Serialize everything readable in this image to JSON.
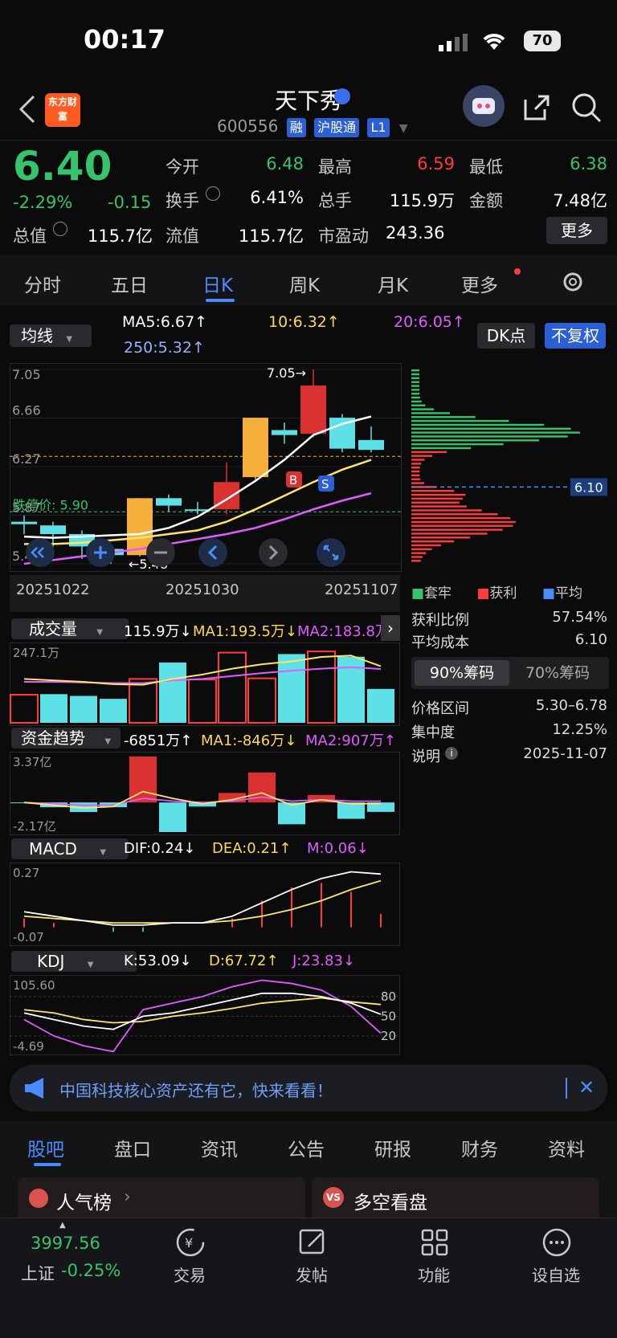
{
  "status": {
    "time": "00:17",
    "battery": "70"
  },
  "header": {
    "logo_text": "东方财富",
    "stock_name": "天下秀",
    "stock_code": "600556",
    "tags": [
      "融",
      "沪股通",
      "L1"
    ]
  },
  "quote": {
    "price": "6.40",
    "change_pct": "-2.29%",
    "change": "-0.15",
    "market_cap_label": "总值",
    "market_cap": "115.7亿",
    "float_cap_label": "流值",
    "float_cap": "115.7亿",
    "open_label": "今开",
    "open": "6.48",
    "high_label": "最高",
    "high": "6.59",
    "low_label": "最低",
    "low": "6.38",
    "turnover_label": "换手",
    "turnover": "6.41%",
    "volume_label": "总手",
    "volume": "115.9万",
    "amount_label": "金额",
    "amount": "7.48亿",
    "pe_label": "市盈动",
    "pe": "243.36",
    "more_button": "更多"
  },
  "period_tabs": [
    "分时",
    "五日",
    "日K",
    "周K",
    "月K",
    "更多"
  ],
  "active_period": "日K",
  "chart_controls": {
    "ma_select": "均线",
    "ma5": "MA5:6.67↑",
    "ma10": "10:6.32↑",
    "ma20": "20:6.05↑",
    "ma250": "250:5.32↑",
    "dk_button": "DK点",
    "adjust_button": "不复权"
  },
  "colors": {
    "up": "#ff3b3b",
    "down": "#5ee1e6",
    "green": "#35c46b",
    "accent": "#4a8cff",
    "ma5": "#ffffff",
    "ma10": "#ffe566",
    "ma20": "#e05cff"
  },
  "chart_data": [
    {
      "type": "candlestick",
      "title": "日K",
      "y_ticks": [
        "7.05",
        "6.66",
        "6.27",
        "5.87",
        "5.48"
      ],
      "ylim": [
        5.48,
        7.05
      ],
      "x_labels": [
        "20251022",
        "20251030",
        "20251107"
      ],
      "annotations": {
        "high_label": "7.05",
        "low_label": "5.48",
        "stop_price_label": "跌停价: 5.90",
        "buy_marker": "B",
        "sell_marker": "S",
        "chip_avg_label": "6.10"
      },
      "candles": [
        {
          "o": 5.82,
          "c": 5.8,
          "h": 5.87,
          "l": 5.72
        },
        {
          "o": 5.79,
          "c": 5.72,
          "h": 5.82,
          "l": 5.55
        },
        {
          "o": 5.72,
          "c": 5.62,
          "h": 5.75,
          "l": 5.52
        },
        {
          "o": 5.6,
          "c": 5.55,
          "h": 5.64,
          "l": 5.48
        },
        {
          "o": 5.55,
          "c": 6.01,
          "h": 6.01,
          "l": 5.54
        },
        {
          "o": 6.01,
          "c": 5.95,
          "h": 6.04,
          "l": 5.9
        },
        {
          "o": 5.92,
          "c": 5.91,
          "h": 5.98,
          "l": 5.88
        },
        {
          "o": 5.92,
          "c": 6.14,
          "h": 6.3,
          "l": 5.88
        },
        {
          "o": 6.18,
          "c": 6.66,
          "h": 6.66,
          "l": 6.16
        },
        {
          "o": 6.56,
          "c": 6.52,
          "h": 6.62,
          "l": 6.45
        },
        {
          "o": 6.53,
          "c": 6.92,
          "h": 7.05,
          "l": 6.5
        },
        {
          "o": 6.66,
          "c": 6.41,
          "h": 6.69,
          "l": 6.38
        },
        {
          "o": 6.48,
          "c": 6.4,
          "h": 6.59,
          "l": 6.38
        }
      ],
      "ma5": [
        5.7,
        5.69,
        5.7,
        5.71,
        5.72,
        5.77,
        5.86,
        6.0,
        6.15,
        6.32,
        6.52,
        6.61,
        6.67
      ],
      "ma10": [
        5.64,
        5.64,
        5.65,
        5.67,
        5.69,
        5.72,
        5.75,
        5.82,
        5.92,
        6.03,
        6.14,
        6.24,
        6.32
      ],
      "ma20": [
        5.48,
        5.51,
        5.54,
        5.57,
        5.6,
        5.64,
        5.68,
        5.72,
        5.77,
        5.84,
        5.92,
        5.99,
        6.05
      ]
    },
    {
      "type": "bar",
      "title": "成交量",
      "label_today": "115.9万↓",
      "ma1_label": "MA1:193.5万↓",
      "ma2_label": "MA2:183.8万",
      "y_top": "247.1万",
      "values": [
        96,
        98,
        92,
        82,
        150,
        206,
        148,
        240,
        152,
        235,
        244,
        226,
        115.9
      ],
      "up": [
        1,
        0,
        0,
        0,
        1,
        0,
        1,
        1,
        1,
        0,
        1,
        0,
        0
      ],
      "ma1": [
        150,
        145,
        140,
        132,
        130,
        150,
        165,
        185,
        200,
        210,
        225,
        230,
        193.5
      ],
      "ma2": [
        140,
        140,
        138,
        136,
        136,
        145,
        150,
        160,
        170,
        178,
        185,
        190,
        183.8
      ]
    },
    {
      "type": "bar",
      "title": "资金趋势",
      "label_today": "-6851万↑",
      "ma1_label": "MA1:-846万↓",
      "ma2_label": "MA2:907万↑",
      "y_top": "3.37亿",
      "y_bottom": "-2.17亿",
      "ylim": [
        -2.17,
        3.37
      ],
      "values": [
        -0.05,
        -0.35,
        -0.7,
        -0.35,
        3.37,
        -2.17,
        -0.3,
        0.7,
        2.2,
        -1.6,
        0.55,
        -1.2,
        -0.69
      ],
      "ma1": [
        0.0,
        -0.2,
        -0.4,
        -0.3,
        0.8,
        0.3,
        -0.1,
        0.2,
        0.7,
        -0.2,
        0.2,
        -0.1,
        -0.08
      ],
      "ma2": [
        0.0,
        -0.1,
        -0.2,
        -0.2,
        0.3,
        0.1,
        0.0,
        0.1,
        0.4,
        0.1,
        0.2,
        0.1,
        0.09
      ]
    },
    {
      "type": "bar",
      "title": "MACD",
      "dif_label": "DIF:0.24↓",
      "dea_label": "DEA:0.21↑",
      "m_label": "M:0.06↓",
      "y_top": "0.27",
      "y_bottom": "-0.07",
      "ylim": [
        -0.07,
        0.27
      ],
      "dif": [
        0.07,
        0.05,
        0.03,
        0.01,
        0.01,
        0.02,
        0.02,
        0.05,
        0.11,
        0.17,
        0.22,
        0.25,
        0.24
      ],
      "dea": [
        0.05,
        0.04,
        0.03,
        0.02,
        0.02,
        0.02,
        0.02,
        0.03,
        0.05,
        0.08,
        0.12,
        0.17,
        0.21
      ],
      "m": [
        0.04,
        0.02,
        0.0,
        -0.02,
        -0.02,
        0.0,
        0.0,
        0.04,
        0.12,
        0.18,
        0.2,
        0.16,
        0.06
      ]
    },
    {
      "type": "line",
      "title": "KDJ",
      "k_label": "K:53.09↓",
      "d_label": "D:67.72↑",
      "j_label": "J:23.83↓",
      "y_top": "105.60",
      "y_bottom": "-4.69",
      "ylim": [
        -4.69,
        105.6
      ],
      "right_ticks": [
        "80",
        "50",
        "20"
      ],
      "k": [
        55,
        45,
        35,
        30,
        50,
        55,
        65,
        75,
        85,
        85,
        80,
        70,
        53
      ],
      "d": [
        60,
        55,
        45,
        40,
        42,
        50,
        55,
        62,
        70,
        74,
        78,
        72,
        68
      ],
      "j": [
        45,
        20,
        5,
        -4,
        60,
        70,
        80,
        95,
        105,
        100,
        90,
        65,
        24
      ]
    }
  ],
  "chip_panel": {
    "legend": [
      "套牢",
      "获利",
      "平均"
    ],
    "profit_ratio_label": "获利比例",
    "profit_ratio": "57.54%",
    "avg_cost_label": "平均成本",
    "avg_cost": "6.10",
    "chip_tabs": [
      "90%筹码",
      "70%筹码"
    ],
    "price_range_label": "价格区间",
    "price_range": "5.30–6.78",
    "concentration_label": "集中度",
    "concentration": "12.25%",
    "note_label": "说明",
    "note_date": "2025-11-07"
  },
  "banner": {
    "text": "中国科技核心资产还有它，快来看看！"
  },
  "bottom_tabs": [
    "股吧",
    "盘口",
    "资讯",
    "公告",
    "研报",
    "财务",
    "资料"
  ],
  "cards": [
    "人气榜",
    "多空看盘"
  ],
  "bottom_nav": {
    "index_value": "3997.56",
    "index_name": "上证",
    "index_change": "-0.25%",
    "items": [
      "交易",
      "发帖",
      "功能",
      "设自选"
    ]
  }
}
